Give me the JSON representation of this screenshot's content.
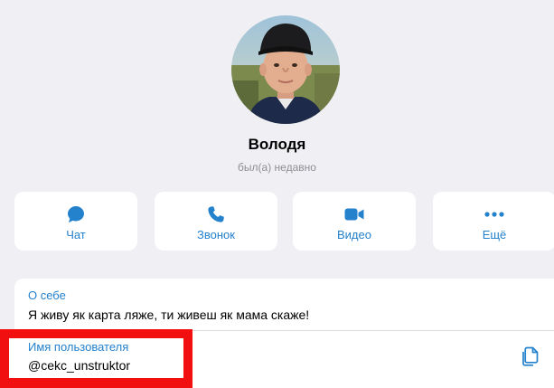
{
  "profile": {
    "name": "Володя",
    "status": "был(а) недавно"
  },
  "actions": [
    {
      "label": "Чат",
      "icon": "chat-bubble-icon"
    },
    {
      "label": "Звонок",
      "icon": "phone-icon"
    },
    {
      "label": "Видео",
      "icon": "video-camera-icon"
    },
    {
      "label": "Ещё",
      "icon": "more-dots-icon"
    }
  ],
  "info": {
    "about_label": "О себе",
    "about_value": "Я живу як карта ляже, ти живеш як мама скаже!",
    "username_label": "Имя пользователя",
    "username_value": "@cekc_unstruktor"
  },
  "colors": {
    "background": "#efeff4",
    "accent": "#2481cc",
    "highlight": "#f10f0f"
  }
}
